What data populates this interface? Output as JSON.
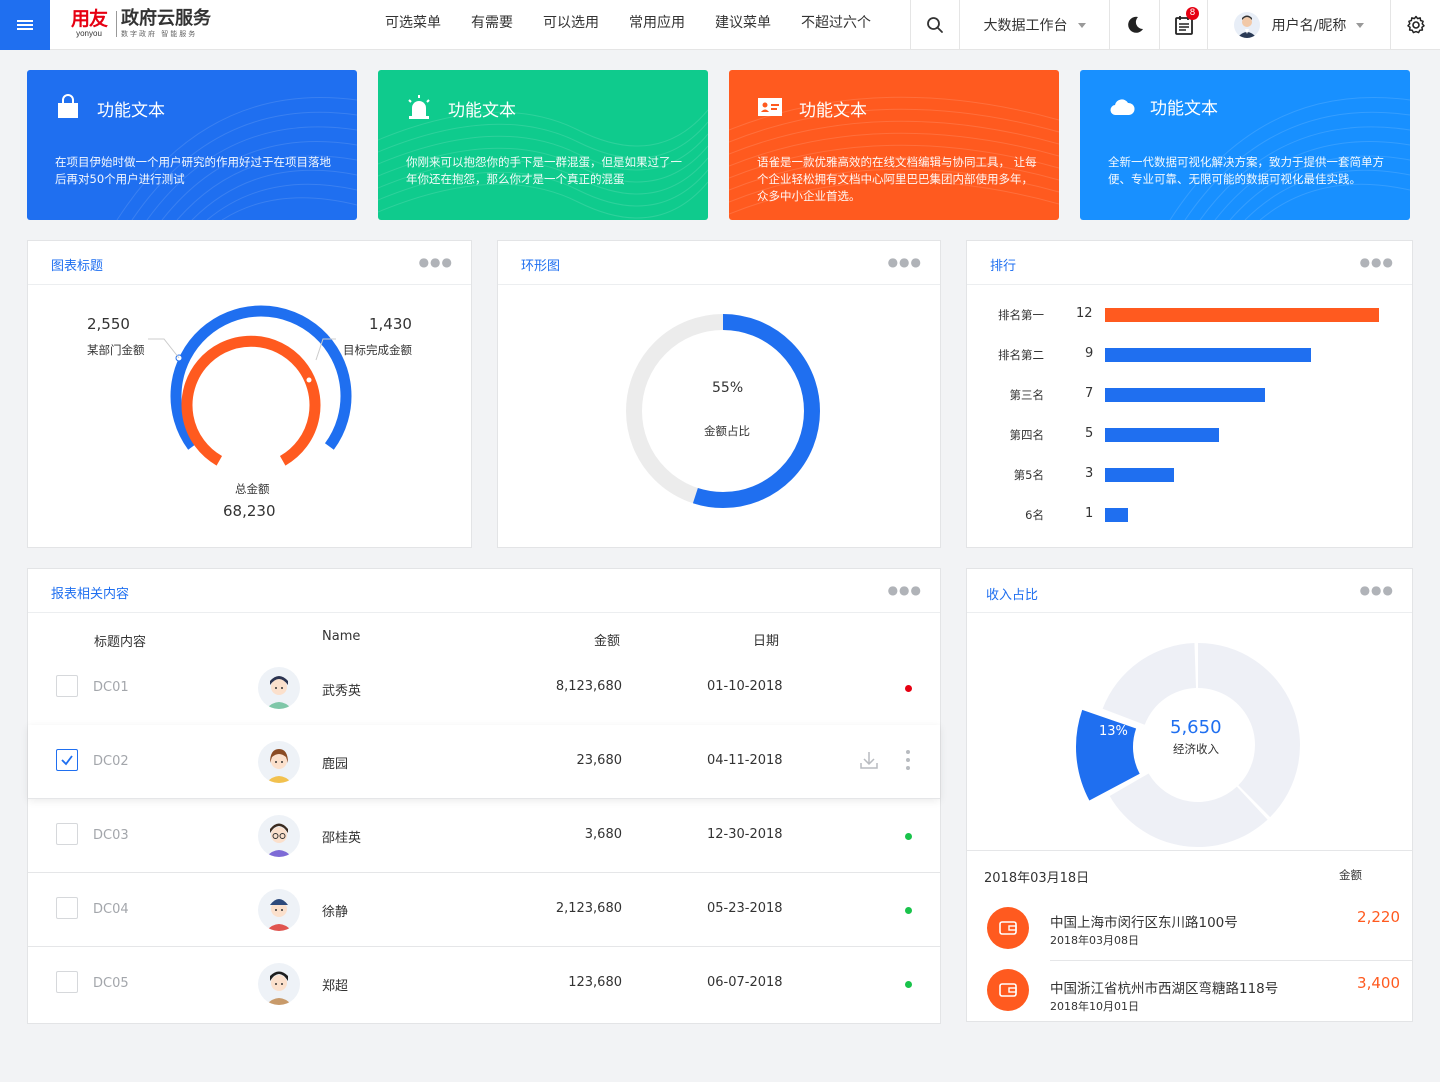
{
  "header": {
    "logo_cn": "用友",
    "logo_en": "yonyou",
    "brand": "政府云服务",
    "brand_sub": "数字政府 智能服务",
    "nav": [
      "可选菜单",
      "有需要",
      "可以选用",
      "常用应用",
      "建议菜单",
      "不超过六个"
    ],
    "workbench": "大数据工作台",
    "notify_count": "8",
    "user_name": "用户名/昵称"
  },
  "feature_cards": [
    {
      "title": "功能文本",
      "desc": "在项目伊始时做一个用户研究的作用好过于在项目落地后再对50个用户进行测试",
      "color": "#1f6ff0",
      "icon": "shopping-bag-icon"
    },
    {
      "title": "功能文本",
      "desc": "你刚来可以抱怨你的手下是一群混蛋，但是如果过了一年你还在抱怨，那么你才是一个真正的混蛋",
      "color": "#0fcb8d",
      "icon": "alarm-light-icon"
    },
    {
      "title": "功能文本",
      "desc": "语雀是一款优雅高效的在线文档编辑与协同工具， 让每个企业轻松拥有文档中心阿里巴巴集团内部使用多年，众多中小企业首选。",
      "color": "#ff5a1f",
      "icon": "id-card-icon"
    },
    {
      "title": "功能文本",
      "desc": "全新一代数据可视化解决方案，致力于提供一套简单方便、专业可靠、无限可能的数据可视化最佳实践。",
      "color": "#1890ff",
      "icon": "cloud-icon"
    }
  ],
  "gauge_panel": {
    "title": "图表标题",
    "left_value": "2,550",
    "left_label": "某部门金额",
    "right_value": "1,430",
    "right_label": "目标完成金额",
    "total_label": "总金额",
    "total_value": "68,230"
  },
  "ring_panel": {
    "title": "环形图",
    "percent": "55%",
    "label": "金额占比",
    "fraction": 0.55
  },
  "rank_panel": {
    "title": "排行"
  },
  "chart_data": {
    "type": "bar",
    "categories": [
      "排名第一",
      "排名第二",
      "第三名",
      "第四名",
      "第5名",
      "6名"
    ],
    "values": [
      12,
      9,
      7,
      5,
      3,
      1
    ],
    "colors": [
      "#ff5a1f",
      "#1f6ff0",
      "#1f6ff0",
      "#1f6ff0",
      "#1f6ff0",
      "#1f6ff0"
    ],
    "orientation": "horizontal",
    "xlim": [
      0,
      12
    ]
  },
  "table_panel": {
    "title": "报表相关内容",
    "headers": [
      "标题内容",
      "Name",
      "金额",
      "日期"
    ],
    "rows": [
      {
        "code": "DC01",
        "name": "武秀英",
        "amount": "8,123,680",
        "date": "01-10-2018",
        "status": "#e60012",
        "checked": false
      },
      {
        "code": "DC02",
        "name": "鹿园",
        "amount": "23,680",
        "date": "04-11-2018",
        "status": "",
        "checked": true
      },
      {
        "code": "DC03",
        "name": "邵桂英",
        "amount": "3,680",
        "date": "12-30-2018",
        "status": "#19c34b",
        "checked": false
      },
      {
        "code": "DC04",
        "name": "徐静",
        "amount": "2,123,680",
        "date": "05-23-2018",
        "status": "#19c34b",
        "checked": false
      },
      {
        "code": "DC05",
        "name": "郑超",
        "amount": "123,680",
        "date": "06-07-2018",
        "status": "#19c34b",
        "checked": false
      }
    ]
  },
  "income_panel": {
    "title": "收入占比",
    "slice_percent": "13%",
    "slice_fraction": 0.13,
    "center_value": "5,650",
    "center_label": "经济收入",
    "date": "2018年03月18日",
    "amount_header": "金额",
    "items": [
      {
        "address": "中国上海市闵行区东川路100号",
        "date": "2018年03月08日",
        "amount": "2,220"
      },
      {
        "address": "中国浙江省杭州市西湖区弯糖路118号",
        "date": "2018年10月01日",
        "amount": "3,400"
      }
    ]
  },
  "colors": {
    "blue": "#1f6ff0",
    "orange": "#ff5a1f",
    "green": "#0fcb8d",
    "sky": "#1890ff"
  }
}
